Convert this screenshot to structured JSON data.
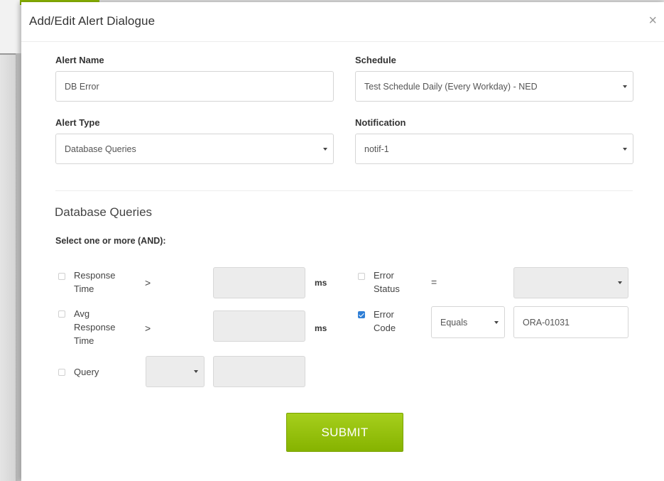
{
  "dialog": {
    "title": "Add/Edit Alert Dialogue",
    "close_glyph": "×"
  },
  "alert_name": {
    "label": "Alert Name",
    "value": "DB Error"
  },
  "schedule": {
    "label": "Schedule",
    "value": "Test Schedule Daily (Every Workday) - NED"
  },
  "alert_type": {
    "label": "Alert Type",
    "value": "Database Queries"
  },
  "notification": {
    "label": "Notification",
    "value": "notif-1"
  },
  "section": {
    "title": "Database Queries",
    "subtitle": "Select one or more (AND):"
  },
  "conditions": {
    "response_time": {
      "label_line1": "Response",
      "label_line2": "Time",
      "operator": ">",
      "value": "",
      "unit": "ms",
      "checked": false
    },
    "avg_response_time": {
      "label_line1": "Avg",
      "label_line2": "Response",
      "label_line3": "Time",
      "operator": ">",
      "value": "",
      "unit": "ms",
      "checked": false
    },
    "query": {
      "label": "Query",
      "operator_value": "",
      "value": "",
      "checked": false
    },
    "error_status": {
      "label_line1": "Error",
      "label_line2": "Status",
      "operator": "=",
      "value": "",
      "checked": false
    },
    "error_code": {
      "label_line1": "Error",
      "label_line2": "Code",
      "operator_value": "Equals",
      "value": "ORA-01031",
      "checked": true
    }
  },
  "submit": {
    "label": "SUBMIT"
  },
  "colors": {
    "accent_green": "#8ab300",
    "checkbox_blue": "#2f7fd6"
  }
}
